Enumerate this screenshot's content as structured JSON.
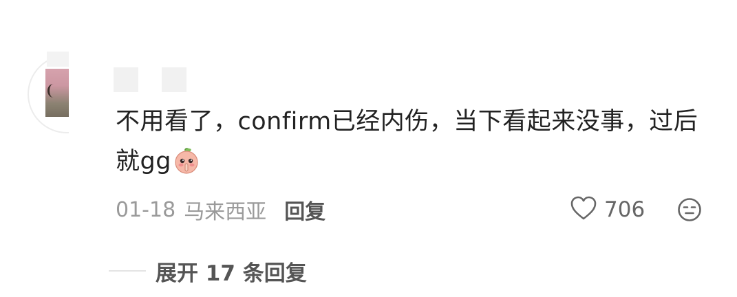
{
  "comment": {
    "text": "不用看了，confirm已经内伤，当下看起来没事，过后就gg",
    "emoji_icon": "peach-shush-emoji-icon",
    "date": "01-18",
    "location": "马来西亚",
    "reply_label": "回复",
    "like_count": "706",
    "like_icon": "heart-outline-icon",
    "dislike_icon": "neutral-face-icon"
  },
  "replies": {
    "expand_label": "展开 17 条回复"
  },
  "colors": {
    "text_primary": "#222222",
    "text_meta": "#9a9a9a",
    "text_action": "#555555",
    "icon_gray": "#666666"
  }
}
